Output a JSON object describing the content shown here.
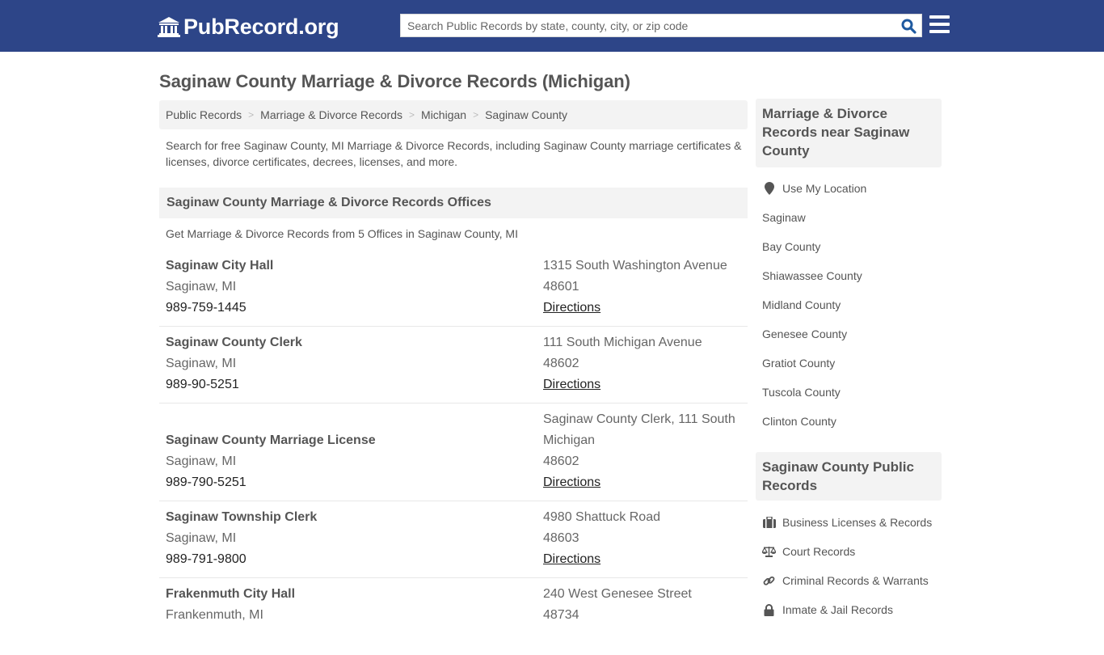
{
  "header": {
    "logo_text": "PubRecord.org",
    "search_placeholder": "Search Public Records by state, county, city, or zip code",
    "colors": {
      "nav_bg": "#2d4588",
      "search_icon": "#1f5aa0"
    }
  },
  "page": {
    "title": "Saginaw County Marriage & Divorce Records (Michigan)",
    "breadcrumb": [
      "Public Records",
      "Marriage & Divorce Records",
      "Michigan",
      "Saginaw County"
    ],
    "intro": "Search for free Saginaw County, MI Marriage & Divorce Records, including Saginaw County marriage certificates & licenses, divorce certificates, decrees, licenses, and more."
  },
  "offices": {
    "heading": "Saginaw County Marriage & Divorce Records Offices",
    "subheading": "Get Marriage & Divorce Records from 5 Offices in Saginaw County, MI",
    "items": [
      {
        "name": "Saginaw City Hall",
        "city": "Saginaw, MI",
        "phone": "989-759-1445",
        "address": "1315 South Washington Avenue",
        "zip": "48601",
        "directions": "Directions"
      },
      {
        "name": "Saginaw County Clerk",
        "city": "Saginaw, MI",
        "phone": "989-90-5251",
        "address": "111 South Michigan Avenue",
        "zip": "48602",
        "directions": "Directions"
      },
      {
        "name": "Saginaw County Marriage License",
        "city": "Saginaw, MI",
        "phone": "989-790-5251",
        "address": "Saginaw County Clerk, 111 South Michigan",
        "zip": "48602",
        "directions": "Directions"
      },
      {
        "name": "Saginaw Township Clerk",
        "city": "Saginaw, MI",
        "phone": "989-791-9800",
        "address": "4980 Shattuck Road",
        "zip": "48603",
        "directions": "Directions"
      },
      {
        "name": "Frakenmuth City Hall",
        "city": "Frankenmuth, MI",
        "phone": "",
        "address": "240 West Genesee Street",
        "zip": "48734",
        "directions": ""
      }
    ]
  },
  "sidebar": {
    "nearby_heading": "Marriage & Divorce Records near Saginaw County",
    "use_location": {
      "label": "Use My Location",
      "icon": "map-marker-icon"
    },
    "nearby": [
      "Saginaw",
      "Bay County",
      "Shiawassee County",
      "Midland County",
      "Genesee County",
      "Gratiot County",
      "Tuscola County",
      "Clinton County"
    ],
    "public_heading": "Saginaw County Public Records",
    "public_records": [
      {
        "label": "Business Licenses & Records",
        "icon": "briefcase-icon"
      },
      {
        "label": "Court Records",
        "icon": "balance-scale-icon"
      },
      {
        "label": "Criminal Records & Warrants",
        "icon": "link-icon"
      },
      {
        "label": "Inmate & Jail Records",
        "icon": "lock-icon"
      }
    ]
  }
}
